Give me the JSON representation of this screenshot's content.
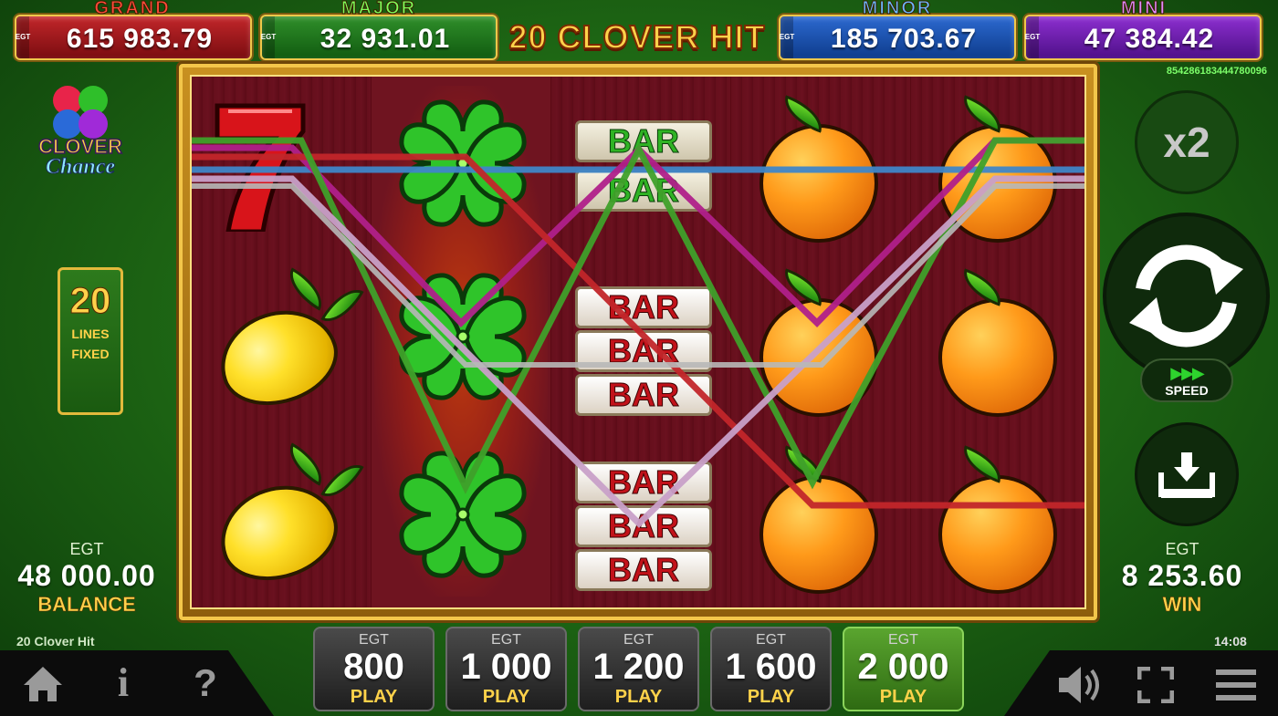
{
  "jackpots": {
    "egt_tag": "EGT",
    "grand": {
      "label": "GRAND",
      "value": "615 983.79",
      "color": "#c2262a"
    },
    "major": {
      "label": "MAJOR",
      "value": "32 931.01",
      "color": "#2f8f2a"
    },
    "minor": {
      "label": "MINOR",
      "value": "185 703.67",
      "color": "#2c69d0"
    },
    "mini": {
      "label": "MINI",
      "value": "47 384.42",
      "color": "#8d2fd0"
    }
  },
  "game_title": "20 CLOVER HIT",
  "game_id": "854286183444780096",
  "logo": {
    "line1": "CLOVER",
    "line2": "Chance"
  },
  "lines": {
    "count": "20",
    "label1": "LINES",
    "label2": "FIXED"
  },
  "balance": {
    "currency": "EGT",
    "amount": "48 000.00",
    "label": "BALANCE"
  },
  "win": {
    "currency": "EGT",
    "amount": "8 253.60",
    "label": "WIN"
  },
  "controls": {
    "multiplier": "x2",
    "speed_label": "SPEED"
  },
  "reels": [
    [
      "seven",
      "lemon",
      "lemon"
    ],
    [
      "clover",
      "clover",
      "clover"
    ],
    [
      "double-bar",
      "triple-bar",
      "triple-bar"
    ],
    [
      "orange",
      "orange",
      "orange"
    ],
    [
      "orange",
      "orange",
      "orange"
    ]
  ],
  "symbol_text": {
    "bar": "BAR"
  },
  "bets": [
    {
      "currency": "EGT",
      "amount": "800",
      "action": "PLAY",
      "selected": false
    },
    {
      "currency": "EGT",
      "amount": "1 000",
      "action": "PLAY",
      "selected": false
    },
    {
      "currency": "EGT",
      "amount": "1 200",
      "action": "PLAY",
      "selected": false
    },
    {
      "currency": "EGT",
      "amount": "1 600",
      "action": "PLAY",
      "selected": false
    },
    {
      "currency": "EGT",
      "amount": "2 000",
      "action": "PLAY",
      "selected": true
    }
  ],
  "footer": {
    "game_name": "20 Clover Hit",
    "clock": "14:08",
    "info_glyph": "i",
    "help_glyph": "?"
  },
  "icons": [
    "home-icon",
    "info-icon",
    "help-icon",
    "sound-icon",
    "fullscreen-icon",
    "menu-icon",
    "spin-icon",
    "collect-icon"
  ],
  "win_line_colors": [
    "#2f6ab8",
    "#c2262a",
    "#2fa02a",
    "#a0208a",
    "#c8a0c8",
    "#a0a0a0"
  ]
}
